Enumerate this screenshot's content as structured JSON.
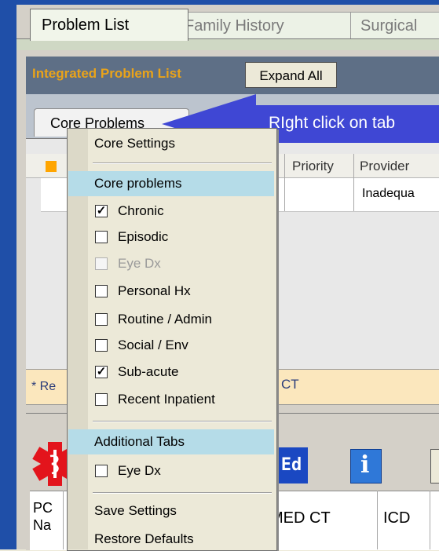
{
  "top_tabs": [
    {
      "label": "Problem List",
      "active": true
    },
    {
      "label": "Family History",
      "active": false
    },
    {
      "label": "Surgical",
      "active": false
    }
  ],
  "header": {
    "integrated_label": "Integrated Problem List",
    "expand_all": "Expand All"
  },
  "core_tab_label": "Core Problems",
  "grid": {
    "columns": [
      "Priority",
      "Provider"
    ],
    "row_provider_partial": "Inadequa"
  },
  "callout_text": "RIght click on tab",
  "note": {
    "left": "* Re",
    "right": "CT"
  },
  "lower": {
    "ed_label": "Ed",
    "columns": {
      "pc": "PC",
      "na": "Na",
      "medct": "MED CT",
      "icd": "ICD"
    }
  },
  "menu": {
    "core_settings": "Core Settings",
    "core_problems_header": "Core problems",
    "items": [
      {
        "label": "Chronic",
        "checked": true,
        "disabled": false
      },
      {
        "label": "Episodic",
        "checked": false,
        "disabled": false
      },
      {
        "label": "Eye Dx",
        "checked": false,
        "disabled": true
      },
      {
        "label": "Personal Hx",
        "checked": false,
        "disabled": false
      },
      {
        "label": "Routine / Admin",
        "checked": false,
        "disabled": false
      },
      {
        "label": "Social / Env",
        "checked": false,
        "disabled": false
      },
      {
        "label": "Sub-acute",
        "checked": true,
        "disabled": false
      },
      {
        "label": "Recent Inpatient",
        "checked": false,
        "disabled": false
      }
    ],
    "additional_tabs_header": "Additional Tabs",
    "additional_items": [
      {
        "label": "Eye Dx",
        "checked": false,
        "disabled": false
      }
    ],
    "save_settings": "Save Settings",
    "restore_defaults": "Restore Defaults"
  },
  "colors": {
    "accent_orange": "#e9a31a",
    "window_blue": "#1f4fa8",
    "callout_blue": "#3f47d4",
    "menu_highlight": "#b5dce8"
  }
}
